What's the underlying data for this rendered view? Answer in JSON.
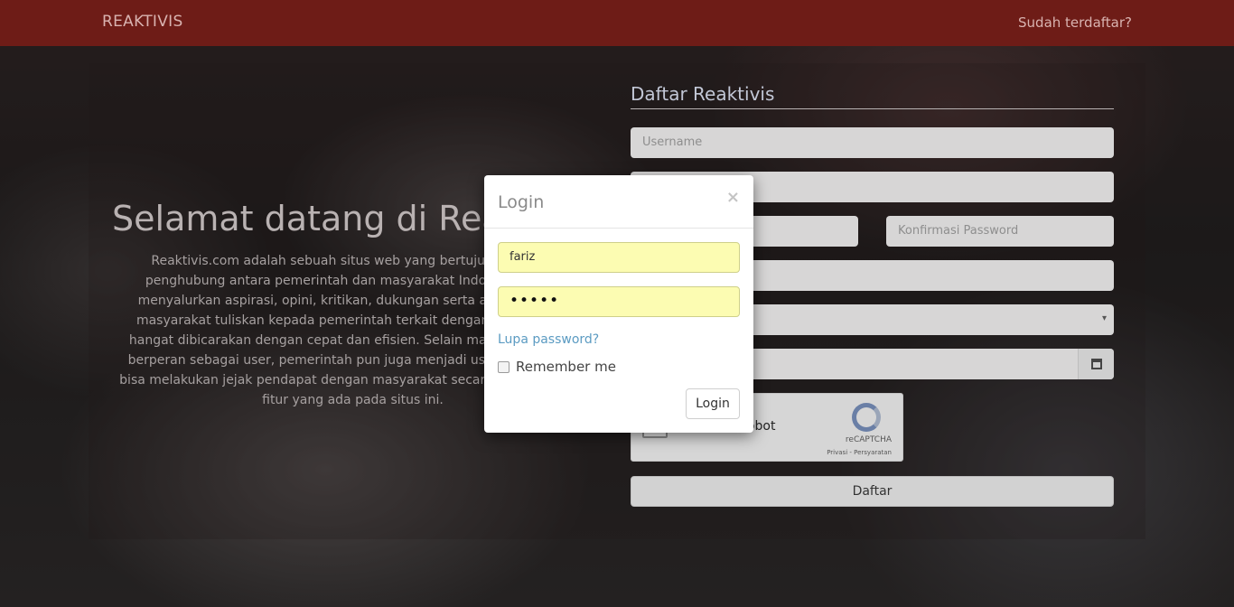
{
  "navbar": {
    "brand": "REAKTIVIS",
    "right_link": "Sudah terdaftar?"
  },
  "welcome": {
    "title": "Selamat datang di Reaktivis",
    "description": "Reaktivis.com adalah sebuah situs web yang bertujuan sebagai penghubung antara pemerintah dan masyarakat Indonesia untuk menyalurkan aspirasi, opini, kritikan, dukungan serta apa saja yang masyarakat tuliskan kepada pemerintah terkait dengan isu-isu yang hangat dibicarakan dengan cepat dan efisien. Selain masyarakat yang berperan sebagai user, pemerintah pun juga menjadi user. Pemerintah bisa melakukan jejak pendapat dengan masyarakat secara online melalui fitur yang ada pada situs ini."
  },
  "register": {
    "title": "Daftar Reaktivis",
    "username_placeholder": "Username",
    "confirm_password_placeholder": "Konfirmasi Password",
    "captcha_label": "I'm not a robot",
    "captcha_brand": "reCAPTCHA",
    "captcha_links": "Privasi - Persyaratan",
    "submit_label": "Daftar"
  },
  "login_modal": {
    "title": "Login",
    "close_symbol": "×",
    "username_value": "fariz",
    "password_value": "•••••",
    "forgot_link": "Lupa password?",
    "remember_label": "Remember me",
    "submit_label": "Login"
  },
  "colors": {
    "navbar": "#6e1c17",
    "autofill": "#fcfcb2",
    "link": "#5b9bc2"
  },
  "icons": {
    "select_caret": "▾",
    "calendar": "calendar-icon"
  }
}
